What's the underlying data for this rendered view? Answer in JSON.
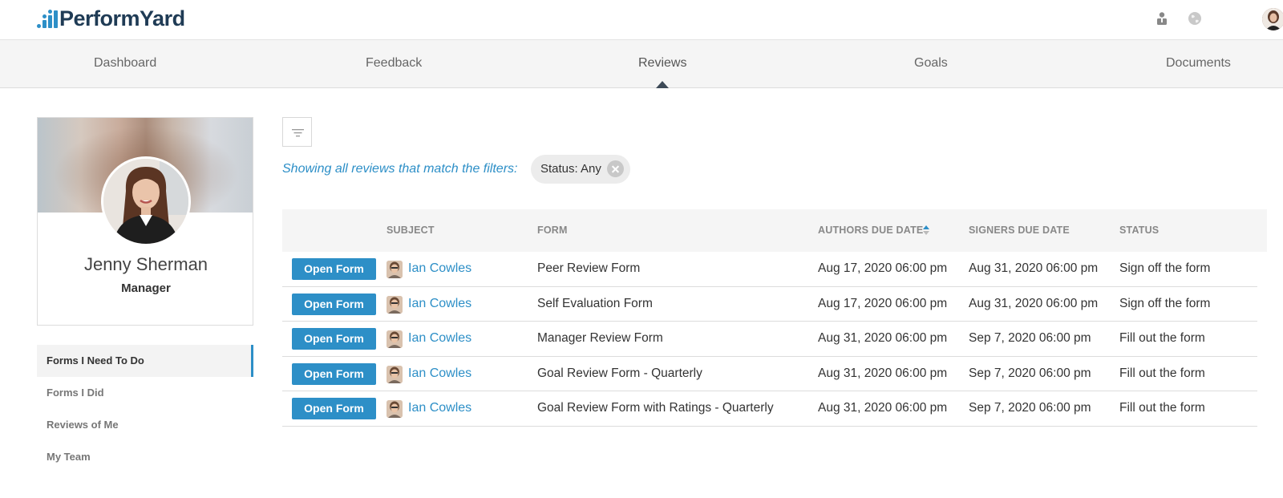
{
  "app": {
    "logo_text": "PerformYard"
  },
  "nav": {
    "items": [
      {
        "label": "Dashboard"
      },
      {
        "label": "Feedback"
      },
      {
        "label": "Reviews"
      },
      {
        "label": "Goals"
      },
      {
        "label": "Documents"
      }
    ],
    "active": "Reviews"
  },
  "profile": {
    "name": "Jenny Sherman",
    "role": "Manager"
  },
  "sidebar": {
    "items": [
      {
        "label": "Forms I Need To Do",
        "active": true
      },
      {
        "label": "Forms I Did",
        "active": false
      },
      {
        "label": "Reviews of Me",
        "active": false
      },
      {
        "label": "My Team",
        "active": false
      }
    ]
  },
  "filters": {
    "summary": "Showing all reviews that match the filters:",
    "chip_label": "Status: Any"
  },
  "table": {
    "headers": {
      "subject": "SUBJECT",
      "form": "FORM",
      "authors_due": "AUTHORS DUE DATE",
      "signers_due": "SIGNERS DUE DATE",
      "status": "STATUS"
    },
    "open_label": "Open Form",
    "rows": [
      {
        "subject": "Ian Cowles",
        "form": "Peer Review Form",
        "authors_due": "Aug 17, 2020 06:00 pm",
        "signers_due": "Aug 31, 2020 06:00 pm",
        "status": "Sign off the form"
      },
      {
        "subject": "Ian Cowles",
        "form": "Self Evaluation Form",
        "authors_due": "Aug 17, 2020 06:00 pm",
        "signers_due": "Aug 31, 2020 06:00 pm",
        "status": "Sign off the form"
      },
      {
        "subject": "Ian Cowles",
        "form": "Manager Review Form",
        "authors_due": "Aug 31, 2020 06:00 pm",
        "signers_due": "Sep 7, 2020 06:00 pm",
        "status": "Fill out the form"
      },
      {
        "subject": "Ian Cowles",
        "form": "Goal Review Form - Quarterly",
        "authors_due": "Aug 31, 2020 06:00 pm",
        "signers_due": "Sep 7, 2020 06:00 pm",
        "status": "Fill out the form"
      },
      {
        "subject": "Ian Cowles",
        "form": "Goal Review Form with Ratings - Quarterly",
        "authors_due": "Aug 31, 2020 06:00 pm",
        "signers_due": "Sep 7, 2020 06:00 pm",
        "status": "Fill out the form"
      }
    ]
  },
  "icons": {
    "logo": "bar-chart-logo-icon",
    "user": "user-icon",
    "globe": "globe-icon",
    "filter": "filter-icon",
    "sort": "sort-icon",
    "close": "close-icon"
  },
  "colors": {
    "accent": "#2d8fc7",
    "brand_dark": "#1f3b55",
    "nav_bg": "#f5f5f5"
  }
}
